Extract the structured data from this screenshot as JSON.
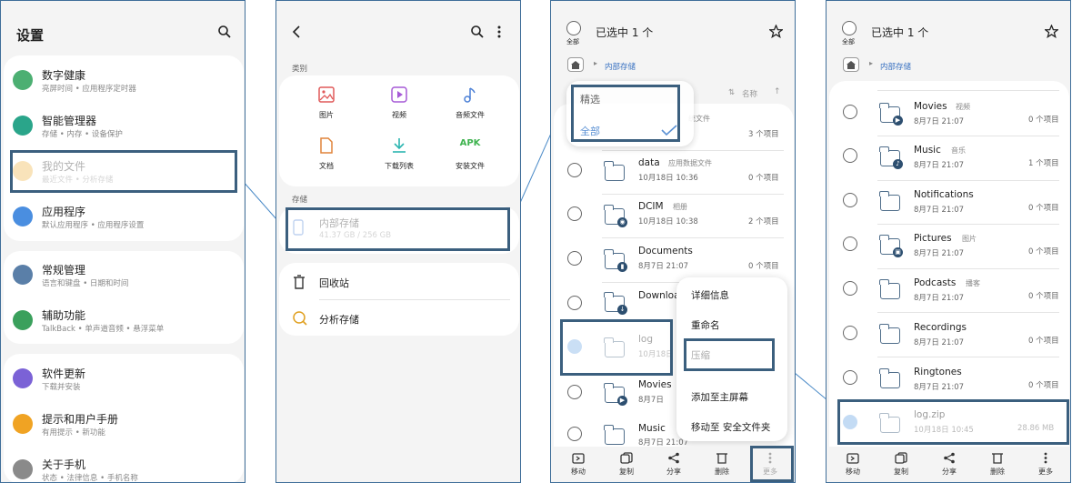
{
  "settings": {
    "title": "设置",
    "items": [
      {
        "label": "数字健康",
        "sub": "亮屏时间 • 应用程序定时器"
      },
      {
        "label": "智能管理器",
        "sub": "存储 • 内存 • 设备保护"
      },
      {
        "label": "我的文件",
        "sub": "最近文件 • 分析存储"
      },
      {
        "label": "应用程序",
        "sub": "默认应用程序 • 应用程序设置"
      },
      {
        "label": "常规管理",
        "sub": "语言和键盘 • 日期和时间"
      },
      {
        "label": "辅助功能",
        "sub": "TalkBack • 单声道音频 • 悬浮菜单"
      },
      {
        "label": "软件更新",
        "sub": "下载并安装"
      },
      {
        "label": "提示和用户手册",
        "sub": "有用提示 • 新功能"
      },
      {
        "label": "关于手机",
        "sub": "状态 • 法律信息 • 手机名称"
      }
    ]
  },
  "myfiles": {
    "category_label": "类别",
    "categories": [
      "图片",
      "视频",
      "音频文件",
      "文档",
      "下载列表",
      "安装文件"
    ],
    "apk_text": "APK",
    "storage_label": "存储",
    "internal_storage": {
      "label": "内部存储",
      "sub": "41.37 GB / 256 GB"
    },
    "recycle_bin": "回收站",
    "analyze_storage": "分析存储"
  },
  "selection": {
    "select_all_label": "全部",
    "selected_title": "已选中 1 个",
    "breadcrumb": "内部存储",
    "sort_label": "名称",
    "filter": {
      "title": "精选",
      "option": "全部"
    },
    "files": [
      {
        "name": "",
        "tag": "统文件",
        "date": "",
        "count": "3 个项目"
      },
      {
        "name": "data",
        "tag": "应用数据文件",
        "date": "10月18日 10:36",
        "count": "0 个项目"
      },
      {
        "name": "DCIM",
        "tag": "相册",
        "date": "10月18日 10:38",
        "count": "2 个项目"
      },
      {
        "name": "Documents",
        "tag": "",
        "date": "8月7日 21:07",
        "count": "0 个项目"
      },
      {
        "name": "Download",
        "tag": "",
        "date": "",
        "count": ""
      },
      {
        "name": "log",
        "tag": "",
        "date": "10月18日",
        "count": ""
      },
      {
        "name": "Movies",
        "tag": "",
        "date": "8月7日",
        "count": ""
      },
      {
        "name": "Music",
        "tag": "",
        "date": "8月7日 21:07",
        "count": ""
      }
    ],
    "context_menu": [
      "详细信息",
      "重命名",
      "压缩",
      "添加至主屏幕",
      "移动至 安全文件夹"
    ],
    "bottom_bar": [
      "移动",
      "复制",
      "分享",
      "删除",
      "更多"
    ]
  },
  "result": {
    "select_all_label": "全部",
    "selected_title": "已选中 1 个",
    "breadcrumb": "内部存储",
    "files": [
      {
        "name": "Movies",
        "tag": "视频",
        "date": "8月7日 21:07",
        "count": "0 个项目"
      },
      {
        "name": "Music",
        "tag": "音乐",
        "date": "8月7日 21:07",
        "count": "1 个项目"
      },
      {
        "name": "Notifications",
        "tag": "",
        "date": "8月7日 21:07",
        "count": "0 个项目"
      },
      {
        "name": "Pictures",
        "tag": "图片",
        "date": "8月7日 21:07",
        "count": "0 个项目"
      },
      {
        "name": "Podcasts",
        "tag": "播客",
        "date": "8月7日 21:07",
        "count": "0 个项目"
      },
      {
        "name": "Recordings",
        "tag": "",
        "date": "8月7日 21:07",
        "count": "0 个项目"
      },
      {
        "name": "Ringtones",
        "tag": "",
        "date": "8月7日 21:07",
        "count": "0 个项目"
      },
      {
        "name": "log.zip",
        "tag": "",
        "date": "10月18日 10:45",
        "count": "28.86 MB"
      }
    ],
    "bottom_bar": [
      "移动",
      "复制",
      "分享",
      "删除",
      "更多"
    ]
  },
  "colors": {
    "highlight": "#3b5f7e",
    "connector": "#4a8ac7",
    "accent_check": "#7cb0e8"
  }
}
